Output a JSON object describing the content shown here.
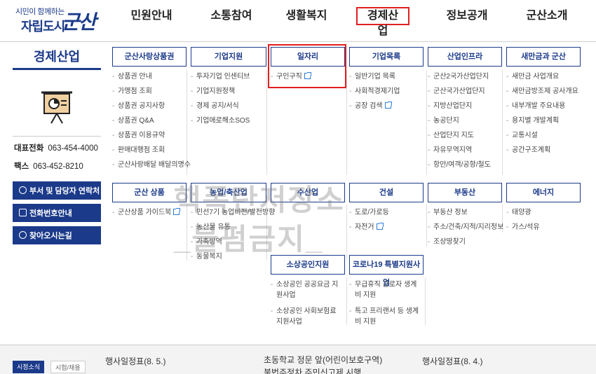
{
  "logo": {
    "slogan": "시민이 함께하는",
    "city": "자립도시",
    "mark": "군산"
  },
  "gnb": [
    "민원안내",
    "소통참여",
    "생활복지",
    "경제산업",
    "정보공개",
    "군산소개"
  ],
  "side": {
    "title": "경제산업",
    "icon": "presentation-board-icon",
    "tel_label": "대표전화",
    "tel": "063-454-4000",
    "fax_label": "팩스",
    "fax": "063-452-8210",
    "buttons": [
      "부서 및 담당자 연락처",
      "전화번호안내",
      "찾아오시는길"
    ]
  },
  "menus": {
    "c1": {
      "head": "군산사랑상품권",
      "items": [
        "상품권 안내",
        "가맹점 조회",
        "상품권 공지사항",
        "상품권 Q&A",
        "상품권 이용규약",
        "판매대행점 조회",
        "군산사랑배달 배달의명수"
      ]
    },
    "c2": {
      "head": "기업지원",
      "items": [
        "투자기업 인센티브",
        "기업지원정책",
        "경제 공지/서식",
        "기업애로해소SOS"
      ]
    },
    "c3": {
      "head": "일자리",
      "items": [
        "구인구직"
      ]
    },
    "c4": {
      "head": "기업목록",
      "items": [
        "일반기업 목록",
        "사회적경제기업",
        "공장 검색"
      ]
    },
    "c5": {
      "head": "산업인프라",
      "items": [
        "군산2국가산업단지",
        "군산국가산업단지",
        "지방산업단지",
        "농공단지",
        "산업단지 지도",
        "자유무역지역",
        "항만/여객/공항/철도"
      ]
    },
    "c6": {
      "head": "새만금과 군산",
      "items": [
        "새만금 사업개요",
        "새만금방조제 공사개요",
        "내부개발 주요내용",
        "용지별 개발계획",
        "교통시설",
        "공간구조계획"
      ]
    },
    "r1": {
      "head": "군산 상품",
      "items": [
        "군산상품 가이드북"
      ]
    },
    "r2": {
      "head": "농업/축산업",
      "items": [
        "민선7기 농업비전/발전방향",
        "농산물 유통",
        "가축방역",
        "동물복지"
      ]
    },
    "r3": {
      "head": "수산업",
      "items": []
    },
    "r4": {
      "head": "건설",
      "items": [
        "도로/가로등",
        "자전거"
      ]
    },
    "r5": {
      "head": "부동산",
      "items": [
        "부동산 정보",
        "주소/건축/지적/지리정보",
        "조상땅찾기"
      ]
    },
    "r6": {
      "head": "에너지",
      "items": [
        "태양광",
        "가스/석유"
      ]
    },
    "s1": {
      "head": "소상공인지원",
      "items": [
        "소상공인 공공요금 지원사업",
        "소상공인 사회보험료 지원사업"
      ]
    },
    "s2": {
      "head": "코로나19 특별지원사업",
      "items": [
        "무급휴직 근로자 생계비 지원",
        "특고 프리랜서 등 생계비 지원"
      ]
    }
  },
  "watermark": {
    "line1": "핵폭탄저장소",
    "line2": "_불펌금지_"
  },
  "bottom": {
    "tabs": [
      "시정소식",
      "시험/채용"
    ],
    "news": [
      "행사일정표(8. 5.)",
      "초동학교 정문 앞(어린이보호구역)",
      "불법주정차 주민신고제 시행",
      "행사일정표(8. 4.)"
    ]
  }
}
